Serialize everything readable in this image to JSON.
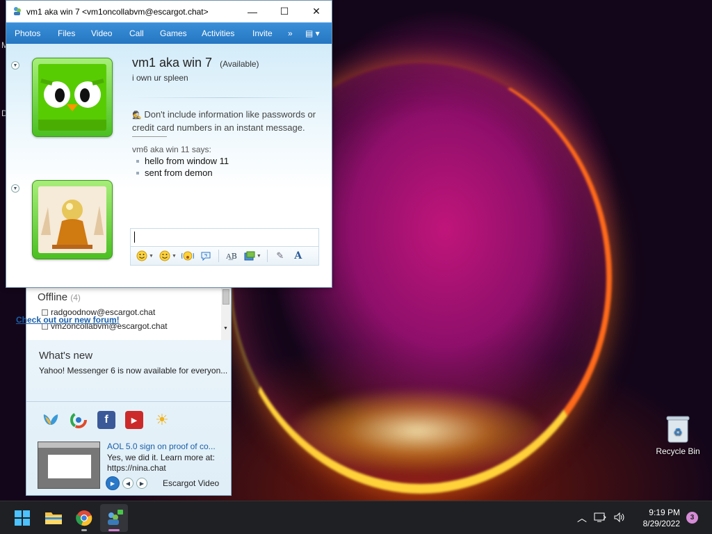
{
  "conversation": {
    "title": "vm1 aka win 7 <vm1oncollabvm@escargot.chat>",
    "menu": [
      "Photos",
      "Files",
      "Video",
      "Call",
      "Games",
      "Activities",
      "Invite",
      "»"
    ],
    "contact_name": "vm1 aka win 7",
    "contact_status": "(Available)",
    "contact_message": "i own ur spleen",
    "warning": "Don't include information like passwords or credit card numbers in an instant message.",
    "sender": "vm6 aka win 11 says:",
    "messages": [
      "hello from window 11",
      "sent from demon"
    ],
    "input_value": "",
    "forum_link": "Check out our new forum!"
  },
  "contact_list": {
    "group_name": "Offline",
    "group_count": "(4)",
    "contacts": [
      "radgoodnow@escargot.chat",
      "vm2oncollabvm@escargot.chat"
    ],
    "whats_new_title": "What's new",
    "whats_new_text": "Yahoo! Messenger 6 is now available for everyon...",
    "video_title": "AOL 5.0 sign on proof of co...",
    "video_desc": "Yes, we did it. Learn more at: https://nina.chat",
    "video_source": "Escargot Video"
  },
  "desktop": {
    "recycle_bin": "Recycle Bin",
    "edge_chars": [
      "M",
      "D"
    ]
  },
  "taskbar": {
    "time": "9:19 PM",
    "date": "8/29/2022",
    "notification_count": "3"
  },
  "colors": {
    "accent": "#2576c2",
    "link": "#1a5fa8",
    "frame_green": "#4bbf22"
  }
}
